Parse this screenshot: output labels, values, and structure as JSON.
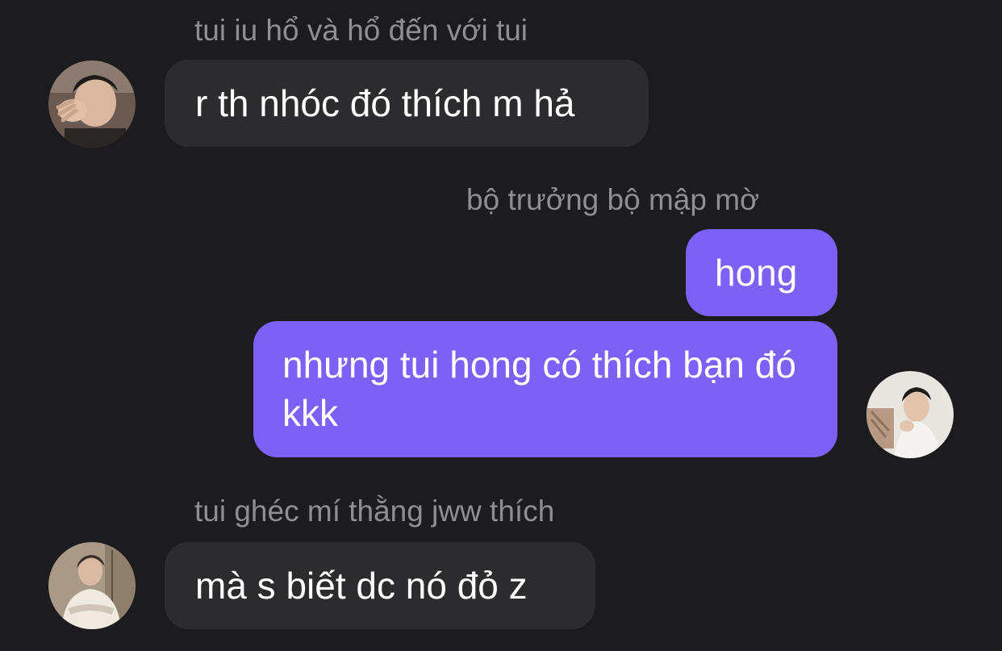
{
  "messages": [
    {
      "sender_name": "tui iu hổ và hổ đến với tui",
      "text": "r th nhóc đó thích m hả",
      "direction": "incoming",
      "avatar": "person-photo-avatar"
    },
    {
      "sender_name": "bộ trưởng bộ mập mờ",
      "texts": [
        "hong",
        "nhưng tui hong có thích bạn đó kkk"
      ],
      "direction": "outgoing",
      "avatar": "person-photo-avatar"
    },
    {
      "sender_name": "tui ghéc mí thằng jww thích",
      "text": "mà s biết dc nó đỏ z",
      "direction": "incoming",
      "avatar": "person-photo-avatar"
    }
  ],
  "colors": {
    "background": "#1c1c1e",
    "incoming_bubble": "#2c2c2e",
    "outgoing_bubble": "#7b61f5",
    "sender_name": "#8e8e93",
    "text": "#ffffff"
  }
}
